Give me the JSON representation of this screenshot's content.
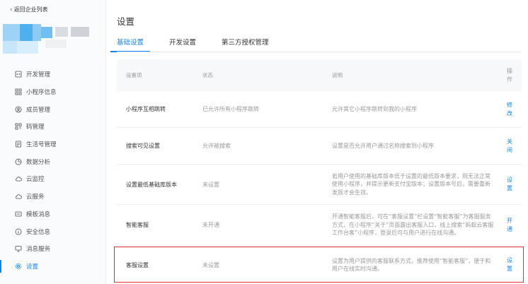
{
  "sidebar": {
    "back_label": "返回企业列表",
    "items": [
      {
        "label": "开发管理",
        "icon": "code-icon"
      },
      {
        "label": "小程序信息",
        "icon": "grid-icon"
      },
      {
        "label": "成员管理",
        "icon": "members-icon"
      },
      {
        "label": "码管理",
        "icon": "qrcode-icon"
      },
      {
        "label": "生活号管理",
        "icon": "document-icon"
      },
      {
        "label": "数据分析",
        "icon": "chart-icon"
      },
      {
        "label": "云监控",
        "icon": "cloud-icon"
      },
      {
        "label": "云服务",
        "icon": "cloud-icon"
      },
      {
        "label": "模板消息",
        "icon": "message-icon"
      },
      {
        "label": "安全信息",
        "icon": "info-icon"
      },
      {
        "label": "消息服务",
        "icon": "monitor-icon"
      },
      {
        "label": "设置",
        "icon": "gear-icon"
      }
    ],
    "active_index": 11
  },
  "main": {
    "title": "设置",
    "tabs": [
      {
        "label": "基础设置"
      },
      {
        "label": "开发设置"
      },
      {
        "label": "第三方授权管理"
      }
    ],
    "active_tab": 0,
    "table": {
      "headers": [
        "设置项",
        "状态",
        "说明",
        "操作"
      ],
      "rows": [
        {
          "item": "小程序互相跳转",
          "status": "已允许所有小程序跳转",
          "desc": "允许其它小程序跳转到我的小程序",
          "action": "修改"
        },
        {
          "item": "搜索可见设置",
          "status": "允许被搜索",
          "desc": "设置是否允许用户通过名称搜索到小程序",
          "action": "关闭"
        },
        {
          "item": "设置最低基础库版本",
          "status": "未设置",
          "desc": "若用户使用的基础库版本低于设置的最低版本要求，则无法正常使用小程序，并提示更新支付宝版本；设置版本号后，需要重新发版才会生效。",
          "action": "设置"
        },
        {
          "item": "智能客服",
          "status": "未开通",
          "desc": "开通智能客服后，可在“客服设置”栏设置“智能客服”为客服服务方式，在小程序“关于”页面露出客服入口，线上搜索“蚂蚁云客服工作台客”小程序，登录后可与用户进行在线沟通。",
          "action": "开通"
        },
        {
          "item": "客服设置",
          "status": "未设置",
          "desc": "设置为用户提供的客服联系方式，推荐使用“智能客服”，便于和用户在线实时沟通。",
          "action": "设置"
        }
      ]
    }
  },
  "colors": {
    "accent": "#1485ee",
    "highlight_border": "#e02e2e"
  }
}
